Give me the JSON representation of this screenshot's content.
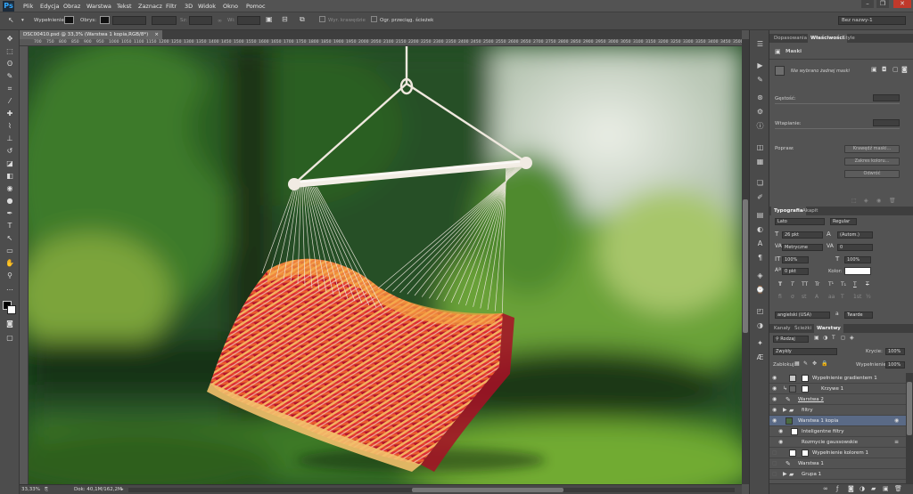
{
  "app": {
    "logo": "Ps"
  },
  "menu": [
    "Plik",
    "Edycja",
    "Obraz",
    "Warstwa",
    "Tekst",
    "Zaznacz",
    "Filtr",
    "3D",
    "Widok",
    "Okno",
    "Pomoc"
  ],
  "window_controls": [
    "–",
    "❐",
    "✕"
  ],
  "options": {
    "fill_label": "Wypełnienie:",
    "stroke_label": "Obrys:",
    "w_label": "Sz:",
    "h_label": "Wi:",
    "align_edges": "Wyr. krawędzie",
    "constrain": "Ogr. przeciąg. ścieżek",
    "workspace": "Bez nazwy-1"
  },
  "document": {
    "tab_title": "DSC00410.psd @ 33,3% (Warstwa 1 kopia,RGB/8*)",
    "close": "×"
  },
  "ruler_ticks": [
    "700",
    "750",
    "800",
    "850",
    "900",
    "950",
    "1000",
    "1050",
    "1100",
    "1150",
    "1200",
    "1250",
    "1300",
    "1350",
    "1400",
    "1450",
    "1500",
    "1550",
    "1600",
    "1650",
    "1700",
    "1750",
    "1800",
    "1850",
    "1900",
    "1950",
    "2000",
    "2050",
    "2100",
    "2150",
    "2200",
    "2250",
    "2300",
    "2350",
    "2400",
    "2450",
    "2500",
    "2550",
    "2600",
    "2650",
    "2700",
    "2750",
    "2800",
    "2850",
    "2900",
    "2950",
    "3000",
    "3050",
    "3100",
    "3150",
    "3200",
    "3250",
    "3300",
    "3350",
    "3400",
    "3450",
    "3500",
    "3550"
  ],
  "status": {
    "zoom": "33,33%",
    "doc": "Dok: 40,1M/162,2M"
  },
  "properties_panel": {
    "tabs": [
      "Dopasowania",
      "Właściwości",
      "Style"
    ],
    "title": "Maski",
    "mask_status": "Nie wybrano żadnej maski",
    "density_label": "Gęstość:",
    "feather_label": "Wtapianie:",
    "refine_label": "Popraw:",
    "refine_edge_btn": "Krawędź maski...",
    "color_range_btn": "Zakres koloru...",
    "invert_btn": "Odwróć"
  },
  "character_panel": {
    "tabs": [
      "Typografia",
      "Akapit"
    ],
    "font": "Lato",
    "style": "Regular",
    "size": "26 pkt",
    "leading": "(Autom.)",
    "kerning": "Metryczne",
    "tracking": "0",
    "vscale": "100%",
    "hscale": "100%",
    "baseline": "0 pkt",
    "color_label": "Kolor:",
    "styles": [
      "T",
      "T",
      "TT",
      "Tr",
      "T¹",
      "T₁",
      "T",
      "T"
    ],
    "features": [
      "fi",
      "σ",
      "st",
      "A",
      "aa",
      "T",
      "1st",
      "½"
    ],
    "language": "angielski (USA)",
    "antialias": "Twarde",
    "aa_icon": "a"
  },
  "layers_panel": {
    "tabs": [
      "Kanały",
      "Ścieżki",
      "Warstwy"
    ],
    "filter_kind": "Rodzaj",
    "blend_mode": "Zwykły",
    "opacity_label": "Krycie:",
    "opacity": "100%",
    "lock_label": "Zablokuj:",
    "fill_label": "Wypełnienie:",
    "fill": "100%",
    "layers": [
      {
        "name": "Wypełnienie gradientem 1",
        "visible": true,
        "selected": false
      },
      {
        "name": "Krzywe 1",
        "visible": true,
        "selected": false
      },
      {
        "name": "Warstwa 2",
        "visible": true,
        "selected": false
      },
      {
        "name": "filtry",
        "visible": true,
        "selected": false
      },
      {
        "name": "Warstwa 1 kopia",
        "visible": true,
        "selected": true
      },
      {
        "name": "Inteligentne filtry",
        "visible": true,
        "selected": false
      },
      {
        "name": "Rozmycie gaussowskie",
        "visible": true,
        "selected": false
      },
      {
        "name": "Wypełnienie kolorem 1",
        "visible": false,
        "selected": false
      },
      {
        "name": "Warstwa 1",
        "visible": false,
        "selected": false
      },
      {
        "name": "Grupa 1",
        "visible": false,
        "selected": false
      }
    ]
  },
  "colors": {
    "bg": "#535353",
    "panel_dark": "#3e3e3e",
    "selected_layer": "#5a6a86",
    "fg_swatch": "#000000",
    "bg_swatch": "#ffffff"
  }
}
